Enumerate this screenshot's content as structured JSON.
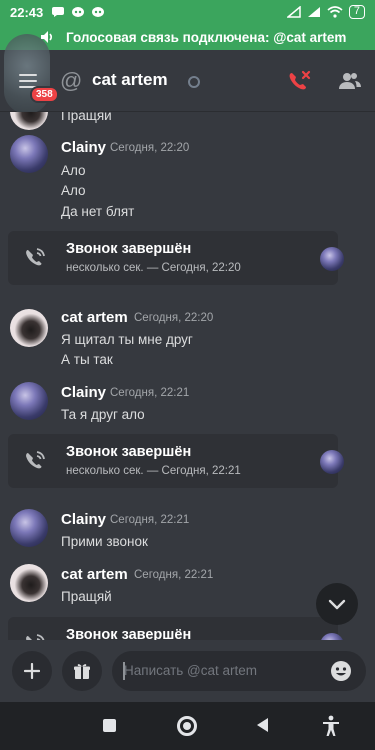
{
  "status_bar": {
    "time": "22:43",
    "battery": "7"
  },
  "voice_bar": {
    "text": "Голосовая связь подключена: @cat artem"
  },
  "header": {
    "title": "cat artem",
    "unread_badge": "358"
  },
  "messages": {
    "top_partial": {
      "text": "Пращяй"
    },
    "m1": {
      "author": "Clainy",
      "time": "Сегодня, 22:20",
      "lines": [
        "Ало",
        "Ало",
        "Да нет блят"
      ]
    },
    "call1": {
      "title": "Звонок завершён",
      "sub": "несколько сек. — Сегодня, 22:20"
    },
    "m2": {
      "author": "cat artem",
      "time": "Сегодня, 22:20",
      "lines": [
        "Я щитал ты мне друг",
        "А ты так"
      ]
    },
    "m3": {
      "author": "Clainy",
      "time": "Сегодня, 22:21",
      "lines": [
        "Та я друг ало"
      ]
    },
    "call2": {
      "title": "Звонок завершён",
      "sub": "несколько сек. — Сегодня, 22:21"
    },
    "m4": {
      "author": "Clainy",
      "time": "Сегодня, 22:21",
      "lines": [
        "Прими звонок"
      ]
    },
    "m5": {
      "author": "cat artem",
      "time": "Сегодня, 22:21",
      "lines": [
        "Пращяй"
      ]
    },
    "call3": {
      "title": "Звонок завершён"
    }
  },
  "composer": {
    "placeholder": "Написать @cat artem"
  },
  "colors": {
    "voice_green": "#3ba55d",
    "background": "#36393f",
    "card": "#2f3136",
    "danger": "#ed4245"
  },
  "icons": [
    "menu-icon",
    "at-icon",
    "end-call-icon",
    "members-icon",
    "call-ended-icon",
    "plus-icon",
    "gift-icon",
    "emoji-icon",
    "chevron-down-icon",
    "speaker-icon"
  ]
}
